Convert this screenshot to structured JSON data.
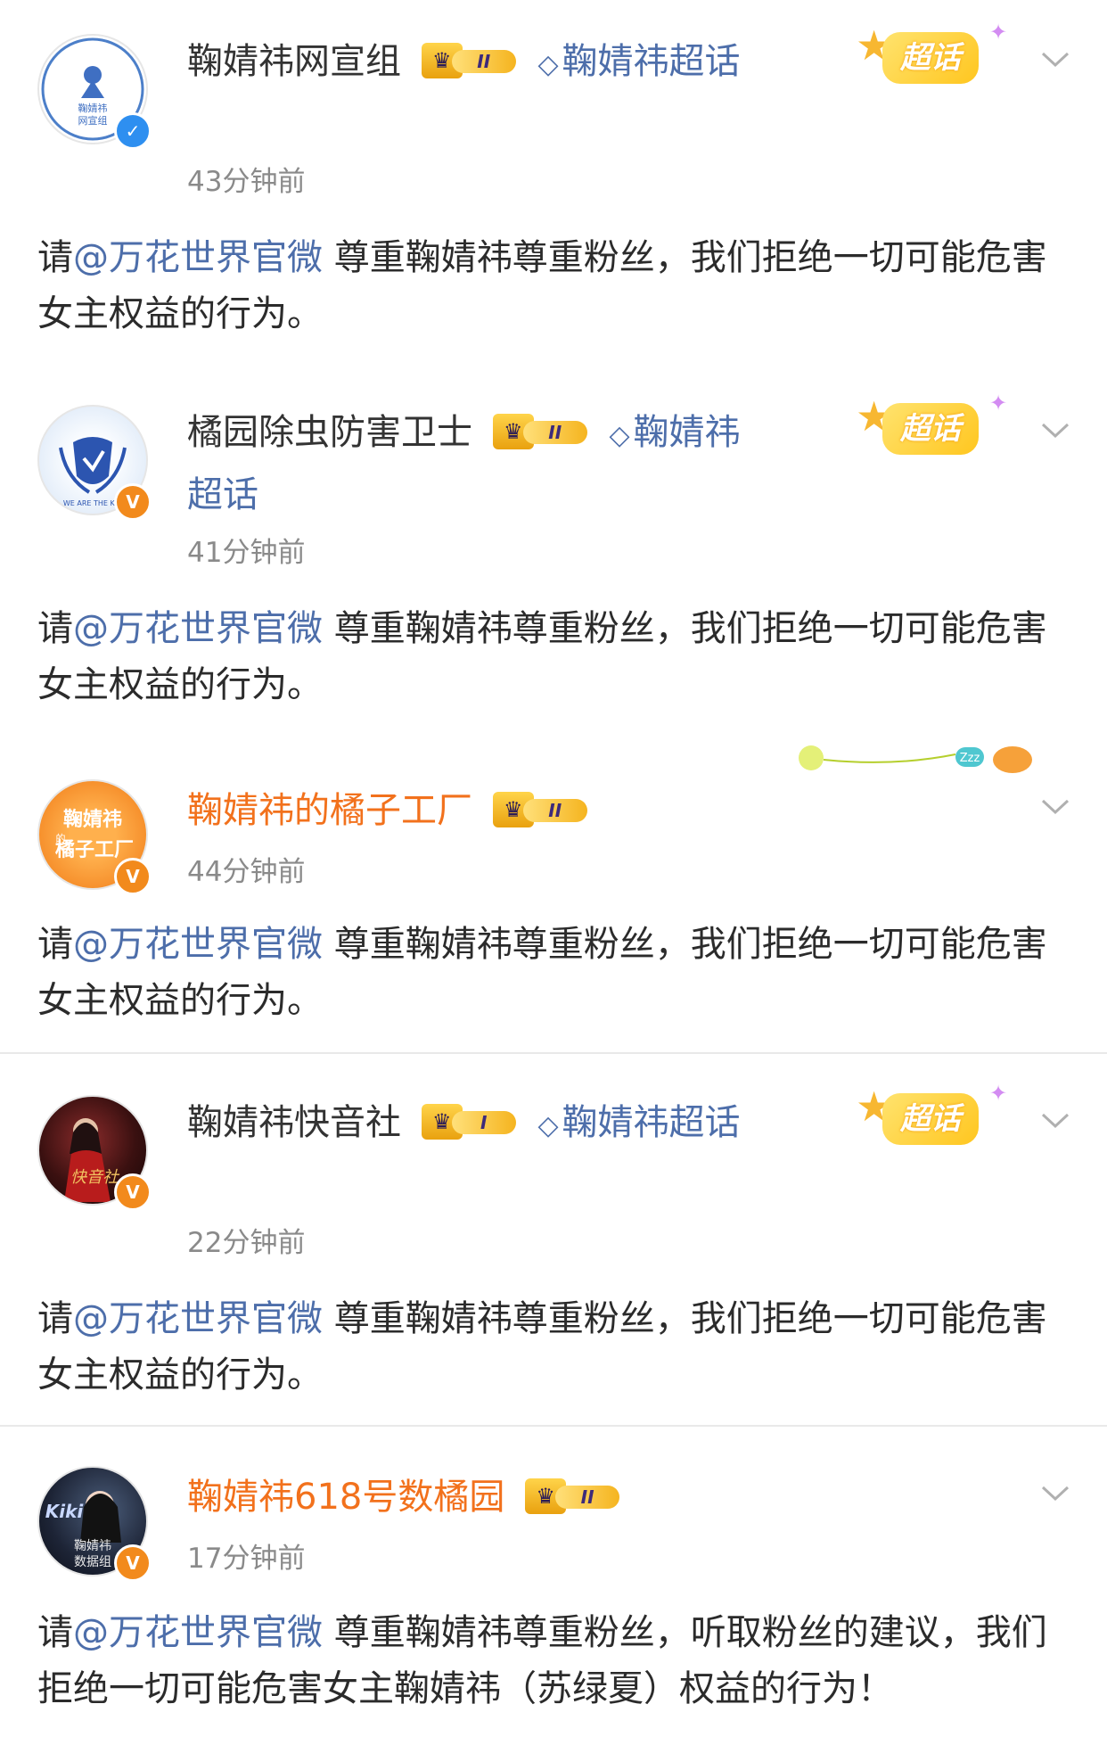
{
  "mention": "@万花世界官微",
  "posts": [
    {
      "username": "鞠婧祎网宣组",
      "level": "II",
      "topic": "鞠婧祎超话",
      "time": "43分钟前",
      "text": "尊重鞠婧祎尊重粉丝，我们拒绝一切可能危害女主权益的行为。",
      "prefix": "请",
      "chaohua": "超话",
      "avatar_text": [
        "鞠婧祎",
        "网宣组"
      ]
    },
    {
      "username": "橘园除虫防害卫士",
      "level": "II",
      "topic": "鞠婧祎超话",
      "time": "41分钟前",
      "text": "尊重鞠婧祎尊重粉丝，我们拒绝一切可能危害女主权益的行为。",
      "prefix": "请",
      "chaohua": "超话",
      "avatar_text": [
        "WE ARE THE KNI"
      ]
    },
    {
      "username": "鞠婧祎的橘子工厂",
      "level": "II",
      "time": "44分钟前",
      "text": "尊重鞠婧祎尊重粉丝，我们拒绝一切可能危害女主权益的行为。",
      "prefix": "请",
      "decor_text": "Zzz",
      "avatar_text": [
        "鞠婧祎",
        "的",
        "橘子工厂"
      ]
    },
    {
      "username": "鞠婧祎快音社",
      "level": "I",
      "topic": "鞠婧祎超话",
      "time": "22分钟前",
      "text": "尊重鞠婧祎尊重粉丝，我们拒绝一切可能危害女主权益的行为。",
      "prefix": "请",
      "chaohua": "超话",
      "avatar_text": [
        "快音社"
      ]
    },
    {
      "username": "鞠婧祎618号数橘园",
      "level": "II",
      "time": "17分钟前",
      "text": "尊重鞠婧祎尊重粉丝，听取粉丝的建议，我们拒绝一切可能危害女主鞠婧祎（苏绿夏）权益的行为！",
      "prefix": "请",
      "avatar_text": [
        "Kiki",
        "鞠婧祎",
        "数据组"
      ]
    }
  ],
  "icons": {
    "verified_blue": "verified-blue-icon",
    "verified_orange": "verified-orange-icon",
    "topic": "diamond-icon",
    "chevron": "chevron-down-icon",
    "crown": "crown-icon"
  },
  "colors": {
    "topic_link": "#4d6eaa",
    "orange_name": "#f2711c",
    "time": "#8a8a8a",
    "text": "#2b2b2b"
  }
}
